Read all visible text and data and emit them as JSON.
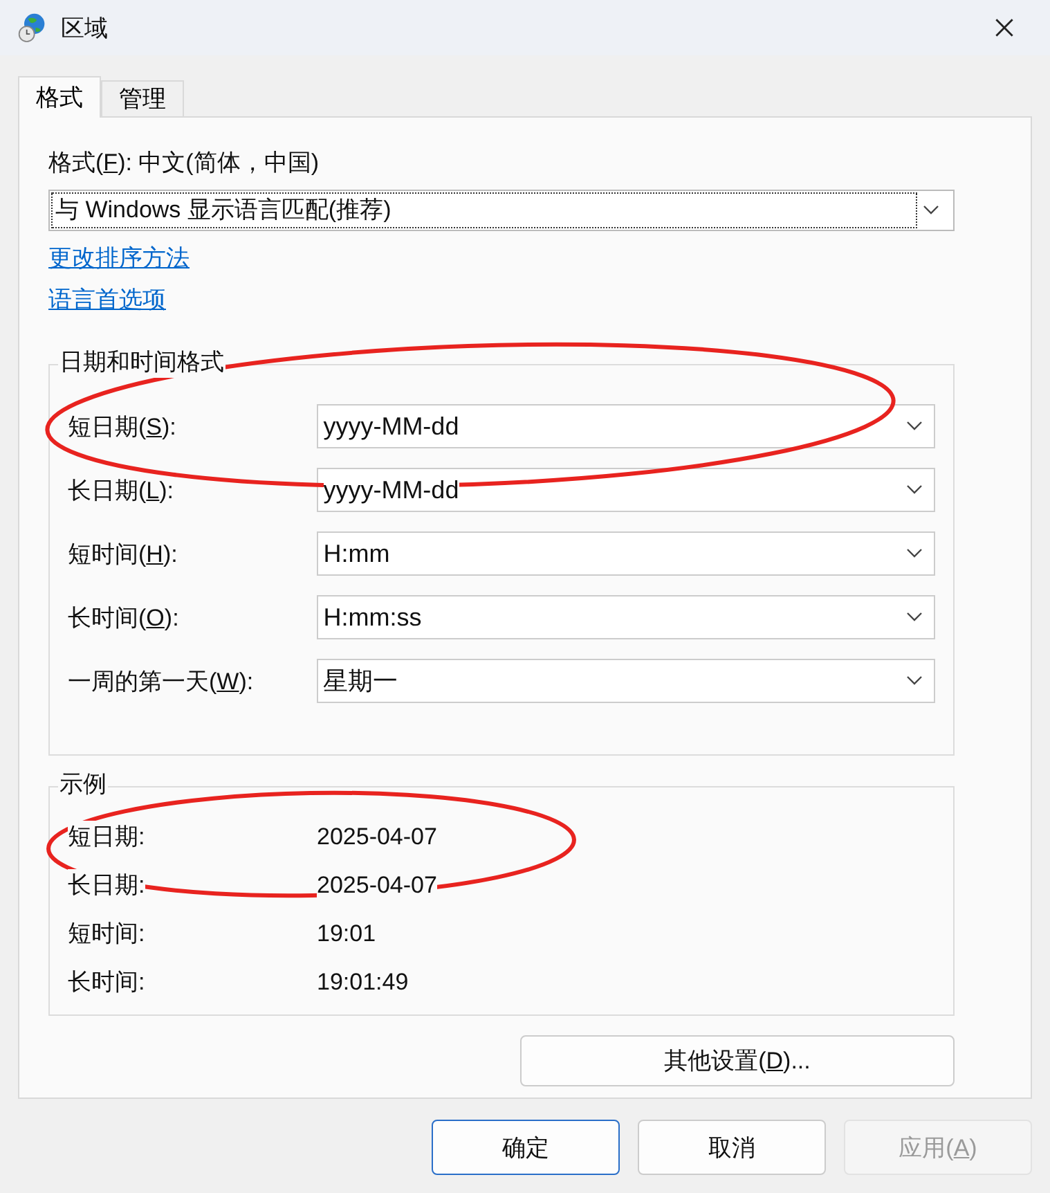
{
  "window": {
    "title": "区域"
  },
  "tabs": [
    {
      "label": "格式",
      "selected": true
    },
    {
      "label": "管理",
      "selected": false
    }
  ],
  "format": {
    "label": {
      "before": "格式(",
      "key": "F",
      "after": "): 中文(简体，中国)"
    },
    "value": "与 Windows 显示语言匹配(推荐)"
  },
  "links": [
    "更改排序方法",
    "语言首选项"
  ],
  "date_time_formats": {
    "title": "日期和时间格式",
    "rows": [
      {
        "label": {
          "before": "短日期(",
          "key": "S",
          "after": "):"
        },
        "value": "yyyy-MM-dd"
      },
      {
        "label": {
          "before": "长日期(",
          "key": "L",
          "after": "):"
        },
        "value": "yyyy-MM-dd"
      },
      {
        "label": {
          "before": "短时间(",
          "key": "H",
          "after": "):"
        },
        "value": "H:mm"
      },
      {
        "label": {
          "before": "长时间(",
          "key": "O",
          "after": "):"
        },
        "value": "H:mm:ss"
      },
      {
        "label": {
          "before": "一周的第一天(",
          "key": "W",
          "after": "):"
        },
        "value": "星期一"
      }
    ]
  },
  "examples": {
    "title": "示例",
    "rows": [
      {
        "label": "短日期:",
        "value": "2025-04-07"
      },
      {
        "label": "长日期:",
        "value": "2025-04-07"
      },
      {
        "label": "短时间:",
        "value": "19:01"
      },
      {
        "label": "长时间:",
        "value": "19:01:49"
      }
    ]
  },
  "other_settings": {
    "before": "其他设置(",
    "key": "D",
    "after": ")..."
  },
  "buttons": [
    {
      "label": {
        "before": "确定"
      },
      "kind": "default",
      "disabled": false
    },
    {
      "label": {
        "before": "取消"
      },
      "kind": "normal",
      "disabled": false
    },
    {
      "label": {
        "before": "应用(",
        "key": "A",
        "after": ")"
      },
      "kind": "normal",
      "disabled": true
    }
  ],
  "annotations": [
    {
      "kind": "ellipse",
      "color": "#e8231f"
    },
    {
      "kind": "ellipse",
      "color": "#e8231f"
    }
  ]
}
